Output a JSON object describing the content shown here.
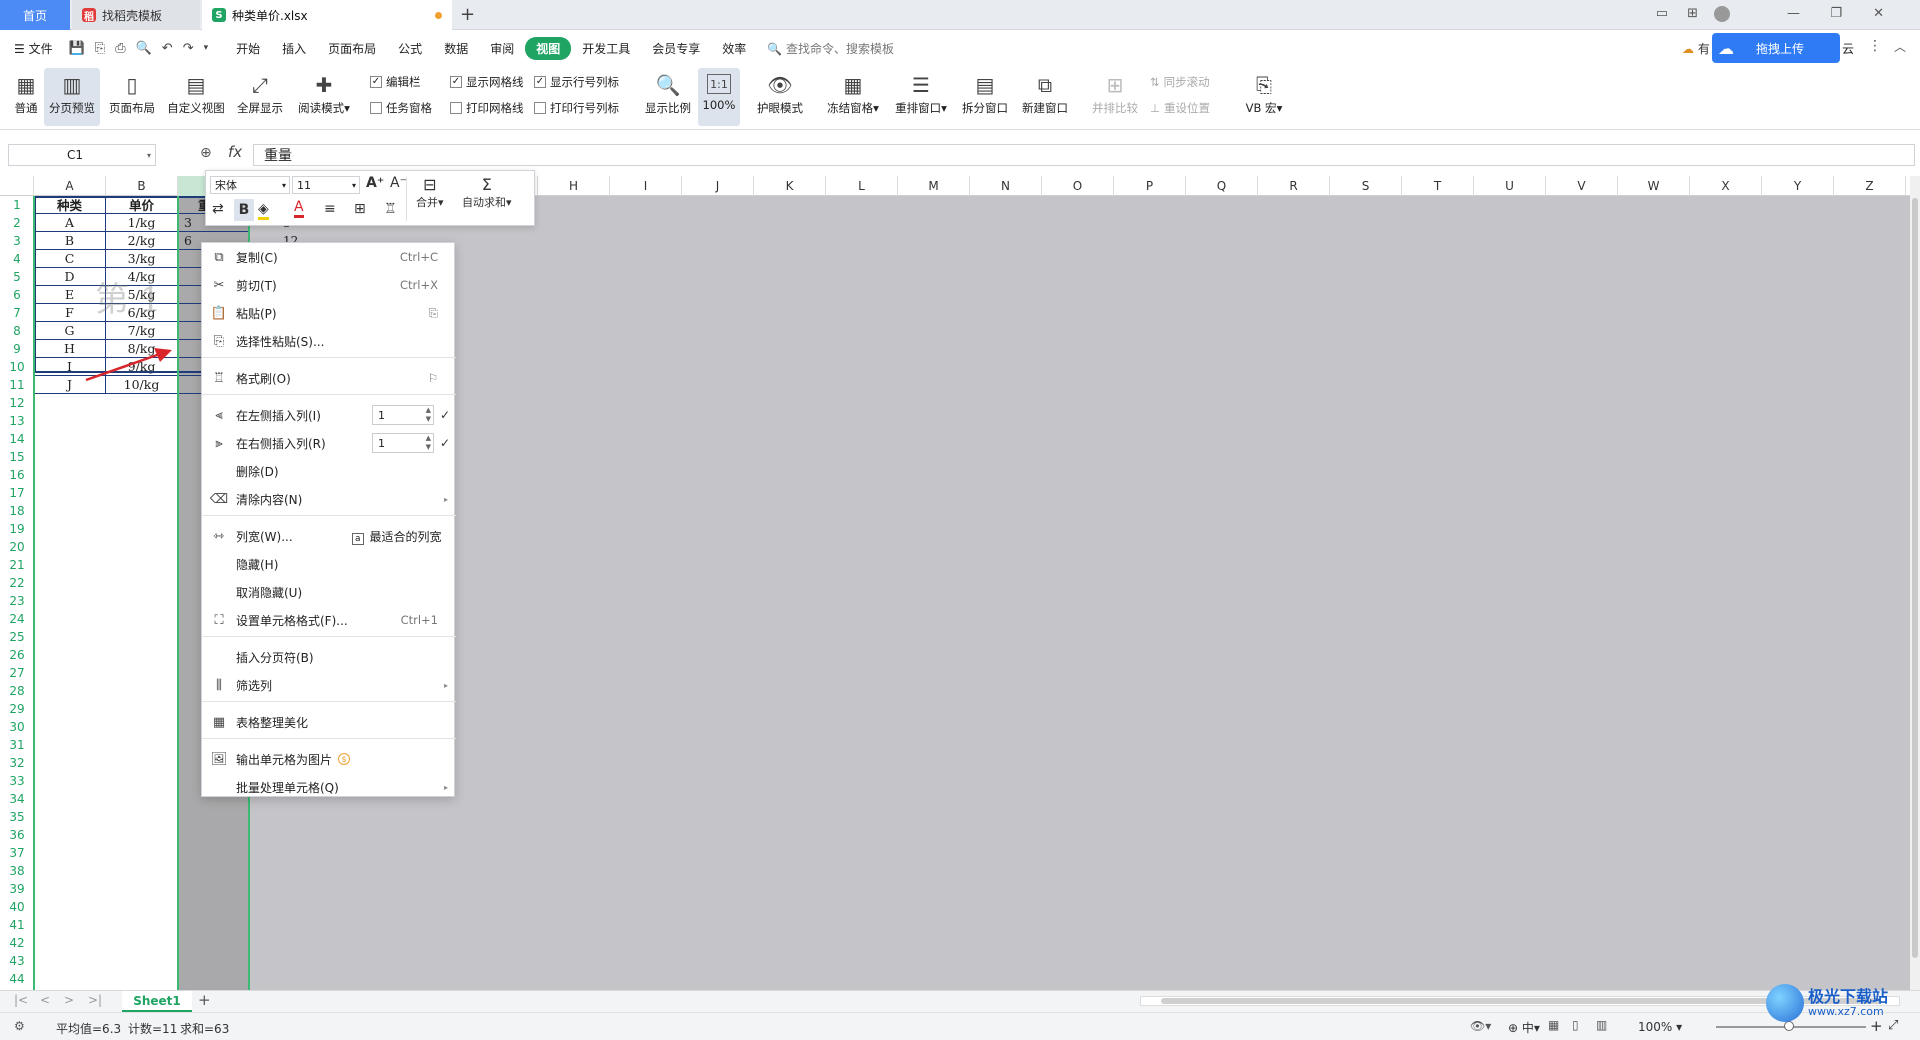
{
  "tabs": {
    "home": "首页",
    "template": "找稻壳模板",
    "file": "种类单价.xlsx",
    "new": "+"
  },
  "menu": {
    "file": "文件",
    "items": [
      "开始",
      "插入",
      "页面布局",
      "公式",
      "数据",
      "审阅",
      "视图",
      "开发工具",
      "会员专享",
      "效率"
    ],
    "active_index": 6,
    "search": "查找命令、搜索模板",
    "upload": "拖拽上传",
    "partial_left": "有",
    "partial_right": "云"
  },
  "ribbon": {
    "normal": "普通",
    "page_break_preview": "分页预览",
    "page_layout": "页面布局",
    "custom_view": "自定义视图",
    "full_screen": "全屏显示",
    "reading_mode": "阅读模式",
    "edit_bar": "编辑栏",
    "task_pane": "任务窗格",
    "show_grid": "显示网格线",
    "print_grid": "打印网格线",
    "show_headers": "显示行号列标",
    "print_headers": "打印行号列标",
    "zoom": "显示比例",
    "zoom100": "100%",
    "zoom100_icon": "1:1",
    "eye_mode": "护眼模式",
    "freeze": "冻结窗格",
    "rearrange": "重排窗口",
    "split": "拆分窗口",
    "new_window": "新建窗口",
    "side_by_side": "并排比较",
    "sync_scroll": "同步滚动",
    "reset_pos": "重设位置",
    "macro": "VB 宏"
  },
  "formula": {
    "cell_ref": "C1",
    "fx": "fx",
    "value": "重量"
  },
  "columns": [
    "A",
    "B",
    "C",
    "D",
    "E",
    "F",
    "G",
    "H",
    "I",
    "J",
    "K",
    "L",
    "M",
    "N",
    "O",
    "P",
    "Q",
    "R",
    "S",
    "T",
    "U",
    "V",
    "W",
    "X",
    "Y",
    "Z"
  ],
  "rows": [
    "1",
    "2",
    "3",
    "4",
    "5",
    "6",
    "7",
    "8",
    "9",
    "10",
    "11",
    "12",
    "13",
    "14",
    "15",
    "16",
    "17",
    "18",
    "19",
    "20",
    "21",
    "22",
    "23",
    "24",
    "25",
    "26",
    "27",
    "28",
    "29",
    "30",
    "31",
    "32",
    "33",
    "34",
    "35",
    "36",
    "37",
    "38",
    "39",
    "40",
    "41",
    "42",
    "43",
    "44"
  ],
  "table": {
    "headers": [
      "种类",
      "单价",
      "重量"
    ],
    "kinds": [
      "A",
      "B",
      "C",
      "D",
      "E",
      "F",
      "G",
      "H",
      "I",
      "J"
    ],
    "prices": [
      "1/kg",
      "2/kg",
      "3/kg",
      "4/kg",
      "5/kg",
      "6/kg",
      "7/kg",
      "8/kg",
      "9/kg",
      "10/kg"
    ],
    "col_c_visible": [
      "3",
      "6"
    ],
    "col_d_visible": [
      "3",
      "12"
    ]
  },
  "watermark": "第 1",
  "mini_toolbar": {
    "font": "宋体",
    "size": "11",
    "bold": "B",
    "font_color": "A",
    "grow": "A⁺",
    "shrink": "A⁻",
    "merge": "合并",
    "autosum": "自动求和"
  },
  "context_menu": {
    "copy": "复制(C)",
    "copy_sc": "Ctrl+C",
    "cut": "剪切(T)",
    "cut_sc": "Ctrl+X",
    "paste": "粘贴(P)",
    "paste_special": "选择性粘贴(S)...",
    "format_painter": "格式刷(O)",
    "insert_left": "在左侧插入列(I)",
    "insert_right": "在右侧插入列(R)",
    "spin_value": "1",
    "delete": "删除(D)",
    "clear": "清除内容(N)",
    "col_width": "列宽(W)...",
    "best_fit": "最适合的列宽",
    "hide": "隐藏(H)",
    "unhide": "取消隐藏(U)",
    "format_cells": "设置单元格格式(F)...",
    "format_sc": "Ctrl+1",
    "insert_page_break": "插入分页符(B)",
    "filter_col": "筛选列",
    "beautify": "表格整理美化",
    "export_image": "输出单元格为图片",
    "batch": "批量处理单元格(Q)"
  },
  "sheet": {
    "name": "Sheet1"
  },
  "status": {
    "avg": "平均值=6.3",
    "count": "计数=11",
    "sum": "求和=63",
    "zoom": "100%",
    "ime": "中"
  },
  "brand": {
    "name": "极光下载站",
    "url": "www.xz7.com"
  },
  "colors": {
    "accent_green": "#1fa463",
    "selection_green": "#3cba74",
    "table_border": "#1e3b7a",
    "arrow_red": "#d9262a",
    "upload_blue": "#2f7bf5"
  }
}
